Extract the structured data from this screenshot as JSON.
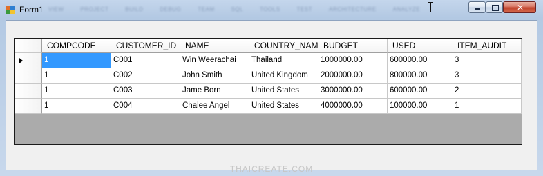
{
  "window": {
    "title": "Form1",
    "blurred_menu": [
      "VIEW",
      "PROJECT",
      "BUILD",
      "DEBUG",
      "TEAM",
      "SQL",
      "TOOLS",
      "TEST",
      "ARCHITECTURE",
      "ANALYZE"
    ]
  },
  "grid": {
    "columns": [
      "COMPCODE",
      "CUSTOMER_ID",
      "NAME",
      "COUNTRY_NAME",
      "BUDGET",
      "USED",
      "ITEM_AUDIT"
    ],
    "rows": [
      [
        "1",
        "C001",
        "Win Weerachai",
        "Thailand",
        "1000000.00",
        "600000.00",
        "3"
      ],
      [
        "1",
        "C002",
        "John  Smith",
        "United Kingdom",
        "2000000.00",
        "800000.00",
        "3"
      ],
      [
        "1",
        "C003",
        "Jame Born",
        "United States",
        "3000000.00",
        "600000.00",
        "2"
      ],
      [
        "1",
        "C004",
        "Chalee Angel",
        "United States",
        "4000000.00",
        "100000.00",
        "1"
      ]
    ],
    "current_row": 0,
    "selected_color": "#3399ff"
  },
  "watermark": "THAICREATE.COM"
}
